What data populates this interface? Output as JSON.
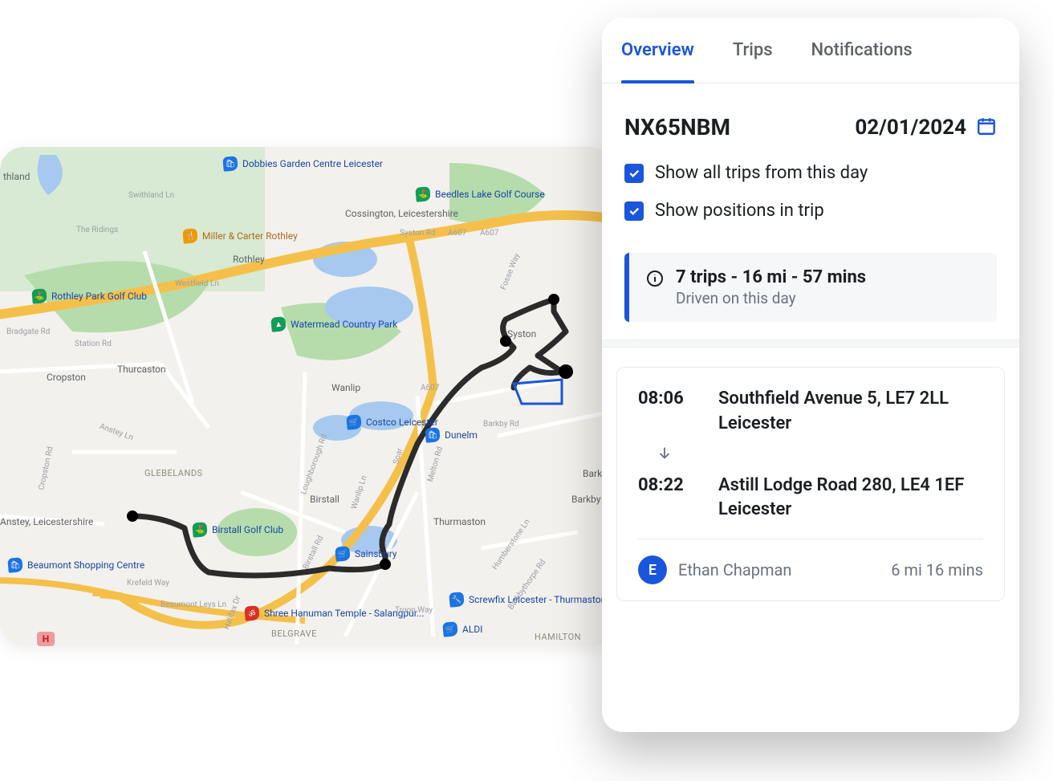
{
  "panel": {
    "tabs": {
      "overview": "Overview",
      "trips": "Trips",
      "notifications": "Notifications"
    },
    "vehicle_id": "NX65NBM",
    "date": "02/01/2024",
    "options": {
      "show_all_trips": "Show all trips from this day",
      "show_positions": "Show positions in trip"
    },
    "summary": {
      "main": "7 trips - 16 mi - 57 mins",
      "sub": "Driven on this day"
    },
    "trip": {
      "start_time": "08:06",
      "start_addr": "Southfield Avenue 5, LE7 2LL Leicester",
      "end_time": "08:22",
      "end_addr": "Astill Lodge Road 280, LE4 1EF Leicester",
      "driver_initial": "E",
      "driver_name": "Ethan Chapman",
      "stats": "6 mi 16 mins"
    }
  },
  "map": {
    "poi": {
      "dobbies": "Dobbies Garden Centre Leicester",
      "beedles": "Beedles Lake Golf Course",
      "cossington": "Cossington, Leicestershire",
      "miller_carter": "Miller & Carter Rothley",
      "rothley": "Rothley",
      "rothley_park": "Rothley Park Golf Club",
      "watermead": "Watermead Country Park",
      "cropston": "Cropston",
      "thurcaston": "Thurcaston",
      "wanlip": "Wanlip",
      "costco": "Costco Leicester",
      "dunelm": "Dunelm",
      "syston": "Syston",
      "glebelands": "GLEBELANDS",
      "birstall": "Birstall",
      "birstall_gc": "Birstall Golf Club",
      "thurmaston": "Thurmaston",
      "beaumont": "Beaumont Shopping Centre",
      "anstey": "Anstey, Leicestershire",
      "sainsbury": "Sainsbury",
      "screwfix": "Screwfix Leicester - Thurmaston",
      "aldi": "ALDI",
      "shree": "Shree Hanuman Temple - Salangpur...",
      "belgrave": "BELGRAVE",
      "hamilton": "HAMILTON",
      "barkby": "Barkb",
      "barkby_thorpe": "Barkby Thorpe",
      "thland": "thland"
    },
    "roads": {
      "a607_1": "A607",
      "a607_2": "A607",
      "a607_3": "A607",
      "swithland": "Swithland Ln",
      "ridings": "The Ridings",
      "westfield": "Westfield Ln",
      "bradgate": "Bradgate Rd",
      "station": "Station Rd",
      "syston_rd": "Syston Rd",
      "fosse": "Fosse Way",
      "melton": "Melton Rd",
      "loughborough": "Loughborough Rd",
      "birstall_rd": "Birstall Rd",
      "wanlip_ln": "Wanlip Ln",
      "soar": "Soar",
      "anstey_ln": "Anstey Ln",
      "cropston_rd": "Cropston Rd",
      "krefeld": "Krefeld Way",
      "beaumont_leys": "Beaumont Leys Ln",
      "halifax": "Halifax Dr",
      "troon": "Troon Way",
      "barkby_rd": "Barkby Rd",
      "humberstone": "Humberstone Ln",
      "barkbythorpe": "Barkbythorpe Rd"
    }
  }
}
